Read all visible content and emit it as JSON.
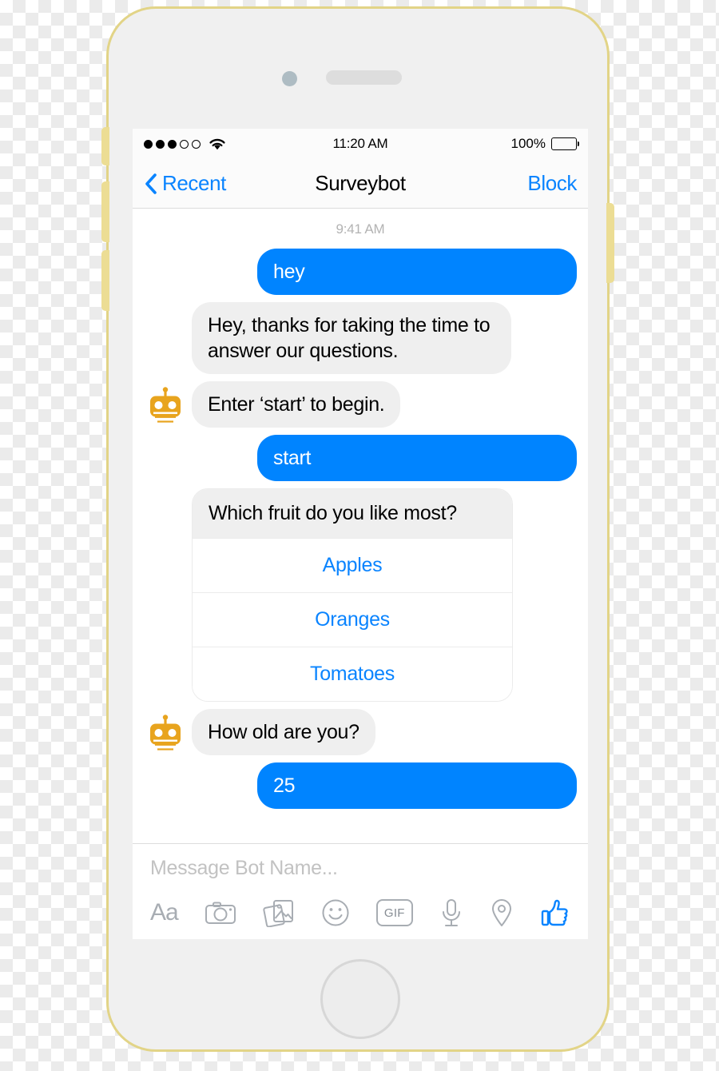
{
  "device": {
    "frame_color": "#e2d487",
    "body_color": "#f0f0f0",
    "camera_name": "front-camera",
    "speaker_name": "earpiece-speaker",
    "home_button_name": "home-button"
  },
  "status_bar": {
    "signal_dots_filled": 3,
    "signal_dots_empty": 2,
    "wifi": "wifi-icon",
    "time": "11:20 AM",
    "battery_percent": "100%",
    "battery_level": 100
  },
  "nav_bar": {
    "back_label": "Recent",
    "title": "Surveybot",
    "action_label": "Block",
    "accent": "#0a84ff"
  },
  "thread": {
    "timestamp": "9:41 AM",
    "bubble_out_color": "#0084ff",
    "bubble_in_color": "#efefef",
    "messages": [
      {
        "id": "m1",
        "side": "out",
        "text": "hey"
      },
      {
        "id": "m2",
        "side": "in",
        "text": "Hey, thanks for taking the time to answer our questions.",
        "avatar": false
      },
      {
        "id": "m3",
        "side": "in",
        "text": "Enter ‘start’ to begin.",
        "avatar": true
      },
      {
        "id": "m4",
        "side": "out",
        "text": "start"
      },
      {
        "id": "m6",
        "side": "in",
        "text": "How old are you?",
        "avatar": true
      },
      {
        "id": "m7",
        "side": "out",
        "text": "25"
      }
    ],
    "quick_reply_card": {
      "question": "Which fruit do you like most?",
      "options": [
        "Apples",
        "Oranges",
        "Tomatoes"
      ],
      "option_color": "#0a84ff"
    }
  },
  "composer": {
    "placeholder": "Message Bot Name...",
    "gif_label": "GIF",
    "aa_label": "Aa",
    "icons": [
      "text-format-icon",
      "camera-icon",
      "photo-gallery-icon",
      "smiley-icon",
      "gif-icon",
      "microphone-icon",
      "location-pin-icon",
      "thumbs-up-icon"
    ],
    "thumbs_up_color": "#0a84ff",
    "icon_color": "#a8adb3"
  }
}
